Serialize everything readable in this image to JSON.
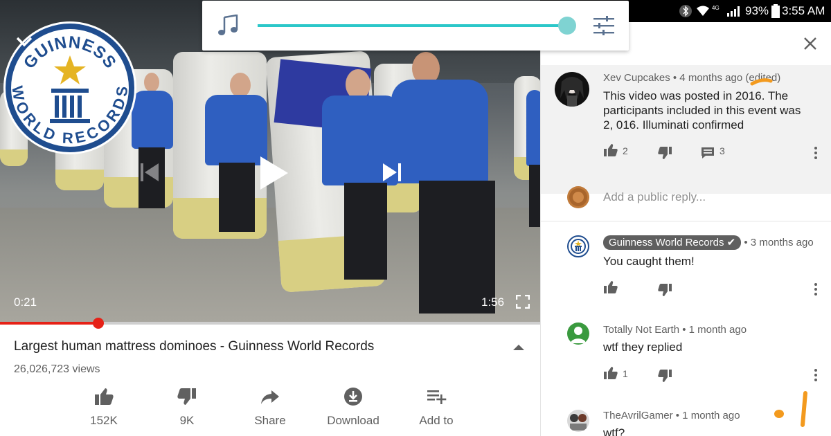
{
  "status_bar": {
    "battery_percent": "93%",
    "clock": "3:55 AM",
    "network_label": "4G",
    "icons": [
      "bluetooth-icon",
      "wifi-icon",
      "signal-icon",
      "battery-icon"
    ]
  },
  "volume_popup": {
    "level_fraction": 0.99,
    "accent_color": "#2bc7c9",
    "icons": [
      "music-note-icon",
      "equalizer-icon"
    ]
  },
  "player": {
    "current_time": "0:21",
    "total_time": "1:56",
    "progress_fraction": 0.182,
    "progress_color": "#e62117",
    "logo_lines": [
      "GUINNESS",
      "WORLD RECORDS"
    ]
  },
  "video": {
    "title": "Largest human mattress dominoes - Guinness World Records",
    "views": "26,026,723 views",
    "actions": [
      {
        "label": "152K",
        "icon": "thumbs-up-icon"
      },
      {
        "label": "9K",
        "icon": "thumbs-down-icon"
      },
      {
        "label": "Share",
        "icon": "share-icon"
      },
      {
        "label": "Download",
        "icon": "download-icon"
      },
      {
        "label": "Add to",
        "icon": "playlist-add-icon"
      }
    ]
  },
  "comments": {
    "reply_placeholder": "Add a public reply...",
    "items": [
      {
        "author": "Xev Cupcakes",
        "meta": "• 4 months ago (edited)",
        "text_lines": [
          "This video was posted in 2016. The",
          "participants included in this event was",
          "2, 016. Illuminati confirmed"
        ],
        "likes": "2",
        "replies": "3"
      },
      {
        "author": "Guinness World Records",
        "verified": true,
        "meta": "• 3 months ago",
        "text_lines": [
          "You caught them!"
        ]
      },
      {
        "author": "Totally Not Earth",
        "meta": "• 1 month ago",
        "text_lines": [
          "wtf they replied"
        ],
        "likes": "1"
      },
      {
        "author": "TheAvrilGamer",
        "meta": "• 1 month ago",
        "text_lines": [
          "wtf?"
        ]
      }
    ]
  }
}
